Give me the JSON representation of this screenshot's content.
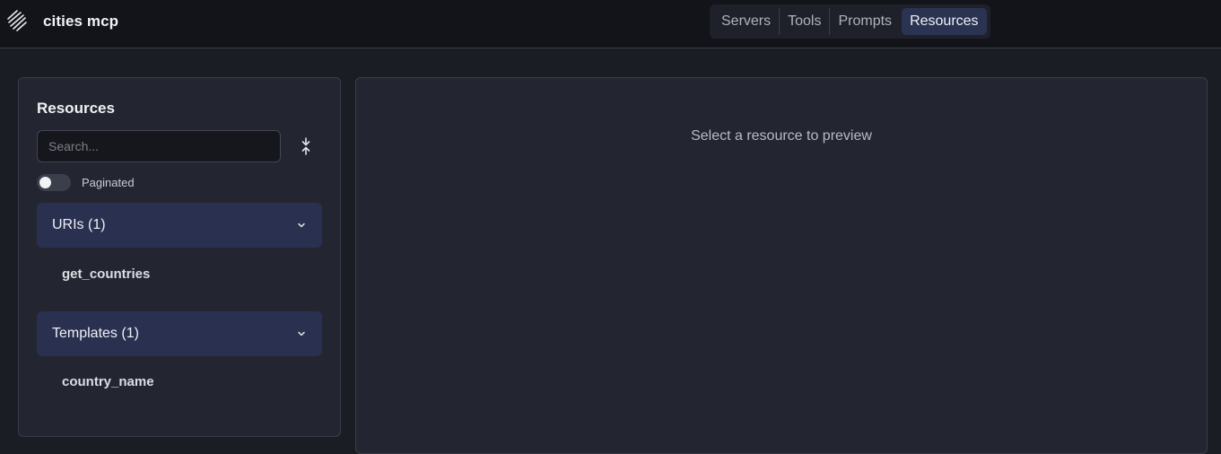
{
  "header": {
    "app_title": "cities mcp",
    "logo_icon": "anthropic-logo-icon",
    "nav": [
      {
        "label": "Servers",
        "active": false
      },
      {
        "label": "Tools",
        "active": false
      },
      {
        "label": "Prompts",
        "active": false
      },
      {
        "label": "Resources",
        "active": true
      }
    ]
  },
  "sidebar": {
    "title": "Resources",
    "search": {
      "placeholder": "Search...",
      "value": ""
    },
    "collapse_icon": "collapse-all-icon",
    "paginated": {
      "label": "Paginated",
      "checked": false
    },
    "groups": [
      {
        "label": "URIs (1)",
        "expanded": true,
        "items": [
          "get_countries"
        ]
      },
      {
        "label": "Templates (1)",
        "expanded": true,
        "items": [
          "country_name"
        ]
      }
    ]
  },
  "preview": {
    "empty_message": "Select a resource to preview"
  },
  "colors": {
    "background": "#1b1d25",
    "panel": "#232631",
    "active_accent": "#2b3352"
  }
}
